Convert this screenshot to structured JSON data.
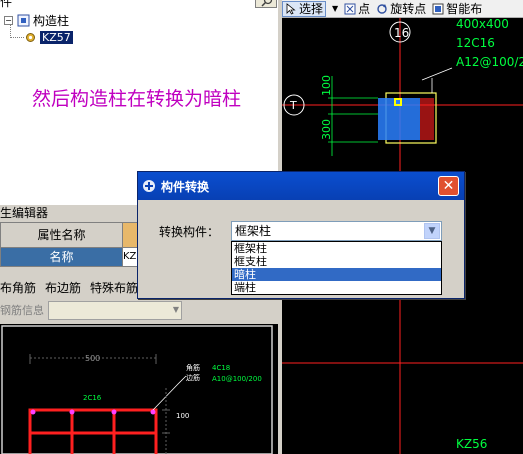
{
  "tree": {
    "partial_top_text": "件",
    "root_label": "构造柱",
    "child_label": "KZ57"
  },
  "annotation": "然后构造柱在转换为暗柱",
  "property_editor": {
    "title": "生编辑器",
    "header_name": "属性名称",
    "row_name": "名称",
    "row_value": "KZ"
  },
  "toolbar2": {
    "items": [
      "布角筋",
      "布边筋",
      "特殊布筋"
    ]
  },
  "rebar_info": {
    "label": "钢筋信息"
  },
  "section_view": {
    "dim_top": "500",
    "corner_label": "角筋",
    "side_label": "边筋",
    "corner_value": "4C18",
    "side_value": "A10@100/200",
    "top_bars": "2C16",
    "dim_side": "100"
  },
  "top_toolbar": {
    "select_label": "选择",
    "point_label": "点",
    "rotate_point_label": "旋转点",
    "smart_label": "智能布"
  },
  "cad": {
    "axis_top": "16",
    "axis_left": "T",
    "size_label": "400x400",
    "main_bars": "12C16",
    "stirrups": "A12@100/2",
    "dim_a": "100",
    "dim_b": "300",
    "bottom_label": "KZ56"
  },
  "dialog": {
    "title": "构件转换",
    "label": "转换构件：",
    "selected_value": "框架柱",
    "options": [
      "框架柱",
      "框支柱",
      "暗柱",
      "端柱"
    ],
    "highlighted_option": "暗柱",
    "close_glyph": "✕"
  },
  "colors": {
    "annotation": "#c000c0",
    "cad_green": "#00ff40",
    "cad_red": "#ff2020",
    "selection_blue": "#316ac5"
  }
}
